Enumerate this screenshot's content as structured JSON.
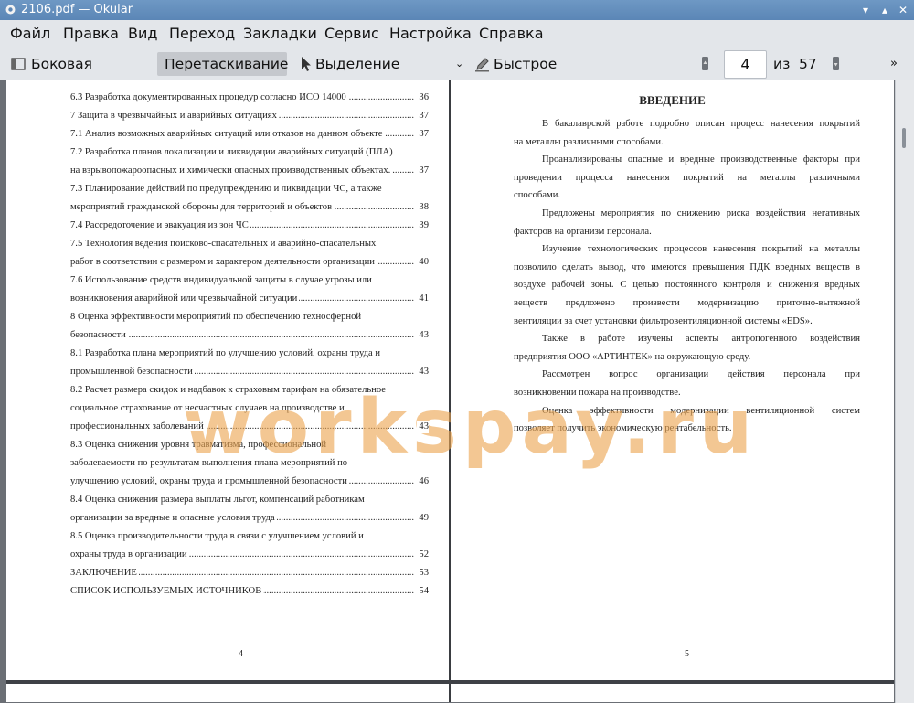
{
  "window": {
    "title": "2106.pdf  — Okular",
    "buttons": [
      "▾",
      "▴",
      "✕"
    ]
  },
  "menu": [
    "Файл",
    "Правка",
    "Вид",
    "Переход",
    "Закладки",
    "Сервис",
    "Настройка",
    "Справка"
  ],
  "toolbar": {
    "sidebar": "Боковая панель",
    "drag": "Перетаскивание",
    "text_select": "Выделение текста",
    "comment": "Быстрое комментирование",
    "page_current": "4",
    "of": "из",
    "page_total": "57"
  },
  "left_page": {
    "toc": [
      {
        "text": "6.3 Разработка документированных процедур согласно ИСО 14000",
        "page": "36"
      },
      {
        "text": "7 Защита в чрезвычайных и аварийных ситуациях",
        "page": "37"
      },
      {
        "text": "7.1 Анализ возможных аварийных ситуаций или отказов на данном объекте",
        "page": "37"
      },
      {
        "text": "7.2 Разработка планов локализации и ликвидации аварийных ситуаций (ПЛА)",
        "page": ""
      },
      {
        "text": "на взрывопожароопасных и химически опасных производственных объектах.",
        "page": "37"
      },
      {
        "text": "7.3 Планирование действий по предупреждению и ликвидации ЧС, а также",
        "page": ""
      },
      {
        "text": "мероприятий гражданской обороны для территорий и объектов",
        "page": "38"
      },
      {
        "text": "7.4 Рассредоточение и эвакуация из зон ЧС",
        "page": "39"
      },
      {
        "text": "7.5 Технология ведения поисково-спасательных и аварийно-спасательных",
        "page": ""
      },
      {
        "text": "работ в соответствии с размером и характером деятельности организации",
        "page": "40"
      },
      {
        "text": "7.6 Использование средств индивидуальной защиты в случае угрозы или",
        "page": ""
      },
      {
        "text": "возникновения аварийной или чрезвычайной ситуации",
        "page": "41"
      },
      {
        "text": "8 Оценка эффективности мероприятий по обеспечению техносферной",
        "page": ""
      },
      {
        "text": "безопасности",
        "page": "43"
      },
      {
        "text": "8.1 Разработка плана мероприятий по улучшению условий, охраны труда и",
        "page": ""
      },
      {
        "text": "промышленной безопасности",
        "page": "43"
      },
      {
        "text": "8.2 Расчет размера скидок и надбавок к страховым тарифам на обязательное",
        "page": ""
      },
      {
        "text": "социальное страхование от несчастных случаев на производстве и",
        "page": ""
      },
      {
        "text": "профессиональных заболеваний",
        "page": "43"
      },
      {
        "text": "8.3 Оценка снижения уровня травматизма, профессиональной",
        "page": ""
      },
      {
        "text": "заболеваемости по результатам выполнения плана мероприятий по",
        "page": ""
      },
      {
        "text": "улучшению условий, охраны труда и промышленной безопасности",
        "page": "46"
      },
      {
        "text": "8.4 Оценка снижения размера выплаты льгот, компенсаций работникам",
        "page": ""
      },
      {
        "text": "организации за вредные и опасные условия труда",
        "page": "49"
      },
      {
        "text": "8.5 Оценка производительности труда в связи с улучшением условий и",
        "page": ""
      },
      {
        "text": "охраны труда в организации",
        "page": "52"
      },
      {
        "text": "ЗАКЛЮЧЕНИЕ",
        "page": "53"
      },
      {
        "text": "СПИСОК ИСПОЛЬЗУЕМЫХ ИСТОЧНИКОВ",
        "page": "54"
      }
    ],
    "page_number": "4"
  },
  "right_page": {
    "title": "ВВЕДЕНИЕ",
    "lines": [
      {
        "text": "В бакалаврской работе подробно описан процесс нанесения покрытий",
        "indent": true,
        "justify": true
      },
      {
        "text": "на металлы различными способами.",
        "indent": false,
        "justify": false
      },
      {
        "text": "Проанализированы опасные и вредные производственные факторы при",
        "indent": true,
        "justify": true
      },
      {
        "text": "проведении процесса нанесения покрытий на металлы различными",
        "indent": false,
        "justify": true
      },
      {
        "text": "способами.",
        "indent": false,
        "justify": false
      },
      {
        "text": "Предложены мероприятия по снижению риска воздействия негативных",
        "indent": true,
        "justify": true
      },
      {
        "text": "факторов на организм персонала.",
        "indent": false,
        "justify": false
      },
      {
        "text": "Изучение технологических процессов нанесения покрытий на металлы",
        "indent": true,
        "justify": true
      },
      {
        "text": "позволило сделать вывод, что имеются превышения ПДК вредных веществ в",
        "indent": false,
        "justify": true
      },
      {
        "text": "воздухе рабочей зоны. С целью постоянного контроля и снижения вредных",
        "indent": false,
        "justify": true
      },
      {
        "text": "веществ предложено произвести модернизацию приточно-вытяжной",
        "indent": false,
        "justify": true
      },
      {
        "text": "вентиляции за счет установки фильтровентиляционной системы «EDS».",
        "indent": false,
        "justify": false
      },
      {
        "text": "Также в работе изучены аспекты антропогенного воздействия",
        "indent": true,
        "justify": true
      },
      {
        "text": "предприятия ООО «АРТИНТЕК» на окружающую среду.",
        "indent": false,
        "justify": false
      },
      {
        "text": "Рассмотрен вопрос организации действия персонала при",
        "indent": true,
        "justify": true
      },
      {
        "text": "возникновении пожара на производстве.",
        "indent": false,
        "justify": false
      },
      {
        "text": "Оценка эффективности модернизации вентиляционной систем",
        "indent": true,
        "justify": true
      },
      {
        "text": "позволяет получить экономическую рентабельность.",
        "indent": false,
        "justify": false
      }
    ],
    "page_number": "5"
  },
  "watermark": "workspay.ru"
}
